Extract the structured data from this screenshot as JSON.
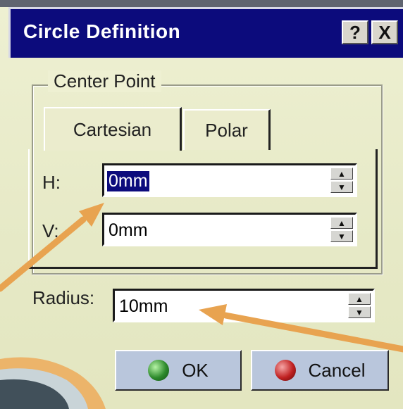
{
  "dialog": {
    "title": "Circle Definition",
    "help_label": "?",
    "close_label": "X"
  },
  "center_point": {
    "group_label": "Center Point",
    "tabs": [
      {
        "label": "Cartesian",
        "active": true
      },
      {
        "label": "Polar",
        "active": false
      }
    ],
    "h": {
      "label": "H:",
      "value": "0mm",
      "selected": true
    },
    "v": {
      "label": "V:",
      "value": "0mm"
    }
  },
  "radius": {
    "label": "Radius:",
    "value": "10mm"
  },
  "buttons": {
    "ok_label": "OK",
    "cancel_label": "Cancel"
  },
  "colors": {
    "titlebar": "#0c0b7c",
    "annotation_arrow": "#e8a350",
    "dialog_bg": "#eef0d2",
    "ok_icon": "#2d8a2c",
    "cancel_icon": "#c02121"
  },
  "icons": {
    "ok": "green-ball-icon",
    "cancel": "red-ball-icon",
    "spin": "up-down-arrow-icon"
  }
}
